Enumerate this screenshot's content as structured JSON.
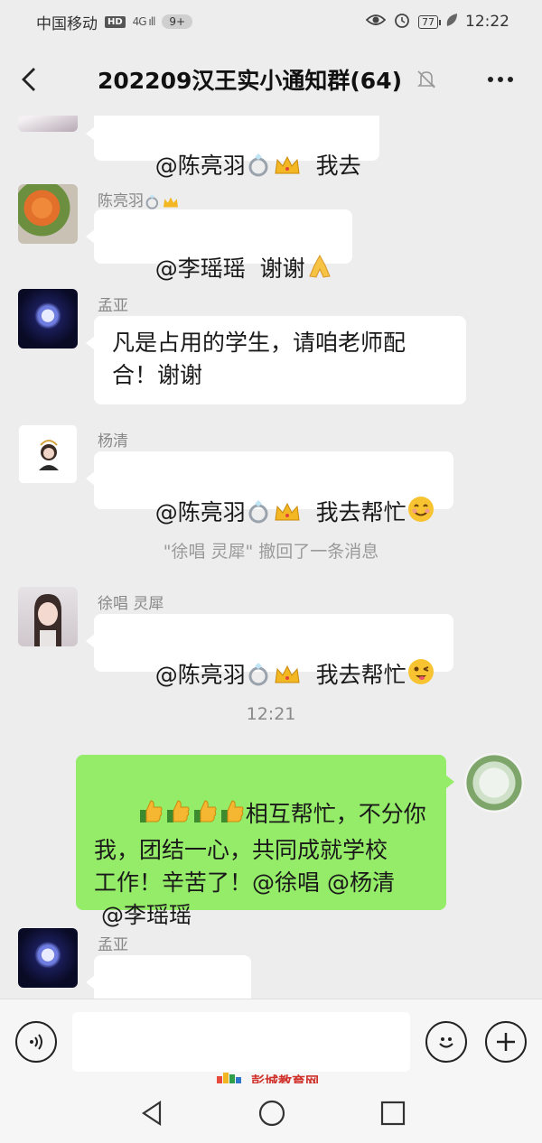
{
  "status": {
    "carrier": "中国移动",
    "hd": "HD",
    "signal": "4G ıll",
    "notif_count": "9+",
    "battery": "77",
    "time": "12:22"
  },
  "header": {
    "title": "202209汉王实小通知群(64)"
  },
  "messages": [
    {
      "sender": "",
      "text": "@陈亮羽",
      "tail": "我去",
      "emoji": [
        "ring-emoji",
        "crown-emoji"
      ]
    },
    {
      "sender": "陈亮羽",
      "text": "@李瑶瑶  谢谢",
      "emoji": [
        "folded-hands-emoji"
      ]
    },
    {
      "sender": "孟亚",
      "text": "凡是占用的学生，请咱老师配\n合！谢谢"
    },
    {
      "sender": "杨清",
      "text": "@陈亮羽",
      "tail": "我去帮忙",
      "emoji": [
        "ring-emoji",
        "crown-emoji",
        "smile-emoji"
      ]
    },
    {
      "sender": "徐唱 灵犀",
      "text": "@陈亮羽",
      "tail": "我去帮忙",
      "emoji": [
        "ring-emoji",
        "crown-emoji",
        "wink-emoji"
      ]
    },
    {
      "sender": "me",
      "text_line1": "相互帮忙，不分你",
      "text_rest": "我，团结一心，共同成就学校\n工作！辛苦了！@徐唱 @杨清\n @李瑶瑶"
    },
    {
      "sender": "孟亚",
      "text": "",
      "emoji": [
        "thumbs-up-emoji"
      ]
    }
  ],
  "system": {
    "recall_notice": "\"徐唱 灵犀\" 撤回了一条消息",
    "timestamp": "12:21"
  },
  "input": {
    "placeholder": ""
  },
  "watermark": {
    "text": "彭城教育网"
  }
}
